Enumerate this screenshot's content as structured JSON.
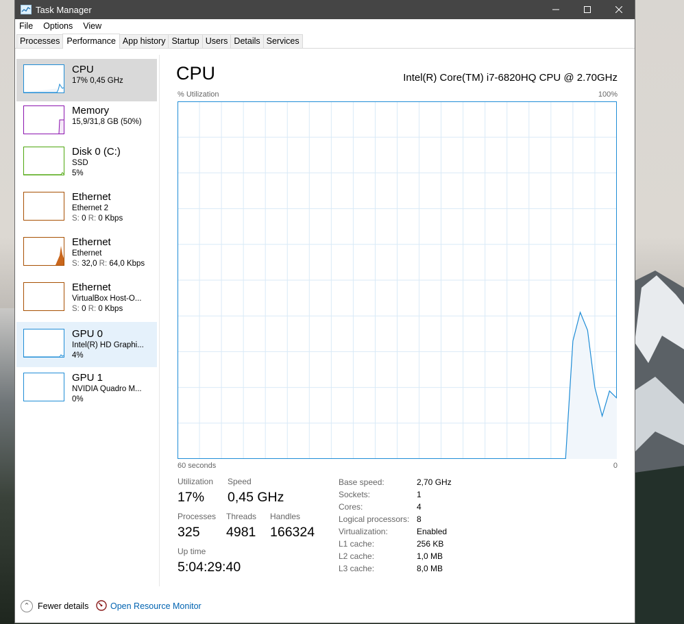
{
  "window": {
    "title": "Task Manager"
  },
  "menu": {
    "items": [
      "File",
      "Options",
      "View"
    ]
  },
  "tabs": [
    "Processes",
    "Performance",
    "App history",
    "Startup",
    "Users",
    "Details",
    "Services"
  ],
  "active_tab": "Performance",
  "sidebar": {
    "items": [
      {
        "name": "CPU",
        "sub": "17% 0,45 GHz",
        "sub2": "",
        "state": "selected",
        "color": "#1e8cd6"
      },
      {
        "name": "Memory",
        "sub": "15,9/31,8 GB (50%)",
        "sub2": "",
        "state": "",
        "color": "#8b12ae"
      },
      {
        "name": "Disk 0 (C:)",
        "sub": "SSD",
        "sub2": "5%",
        "state": "",
        "color": "#4da60c"
      },
      {
        "name": "Ethernet",
        "sub": "Ethernet 2",
        "sub2_label_s": "S:",
        "sub2_val_s": "0",
        "sub2_label_r": "R:",
        "sub2_val_r": "0 Kbps",
        "state": "",
        "color": "#a74f01"
      },
      {
        "name": "Ethernet",
        "sub": "Ethernet",
        "sub2_label_s": "S:",
        "sub2_val_s": "32,0",
        "sub2_label_r": "R:",
        "sub2_val_r": "64,0 Kbps",
        "state": "",
        "color": "#a74f01"
      },
      {
        "name": "Ethernet",
        "sub": "VirtualBox Host-O...",
        "sub2_label_s": "S:",
        "sub2_val_s": "0",
        "sub2_label_r": "R:",
        "sub2_val_r": "0 Kbps",
        "state": "",
        "color": "#a74f01"
      },
      {
        "name": "GPU 0",
        "sub": "Intel(R) HD Graphi...",
        "sub2": "4%",
        "state": "hover",
        "color": "#1e8cd6"
      },
      {
        "name": "GPU 1",
        "sub": "NVIDIA Quadro M...",
        "sub2": "0%",
        "state": "",
        "color": "#1e8cd6"
      }
    ]
  },
  "main": {
    "title": "CPU",
    "model": "Intel(R) Core(TM) i7-6820HQ CPU @ 2.70GHz",
    "graph_label": "% Utilization",
    "graph_max": "100%",
    "time_left": "60 seconds",
    "time_right": "0",
    "stats": {
      "utilization_label": "Utilization",
      "utilization": "17%",
      "speed_label": "Speed",
      "speed": "0,45 GHz",
      "processes_label": "Processes",
      "processes": "325",
      "threads_label": "Threads",
      "threads": "4981",
      "handles_label": "Handles",
      "handles": "166324",
      "uptime_label": "Up time",
      "uptime": "5:04:29:40"
    },
    "details": [
      {
        "label": "Base speed:",
        "value": "2,70 GHz"
      },
      {
        "label": "Sockets:",
        "value": "1"
      },
      {
        "label": "Cores:",
        "value": "4"
      },
      {
        "label": "Logical processors:",
        "value": "8"
      },
      {
        "label": "Virtualization:",
        "value": "Enabled"
      },
      {
        "label": "L1 cache:",
        "value": "256 KB"
      },
      {
        "label": "L2 cache:",
        "value": "1,0 MB"
      },
      {
        "label": "L3 cache:",
        "value": "8,0 MB"
      }
    ]
  },
  "cpu_history": [
    0,
    0,
    0,
    0,
    0,
    0,
    0,
    0,
    0,
    0,
    0,
    0,
    0,
    0,
    0,
    0,
    0,
    0,
    0,
    0,
    0,
    0,
    0,
    0,
    0,
    0,
    0,
    0,
    0,
    0,
    0,
    0,
    0,
    0,
    0,
    0,
    0,
    0,
    0,
    0,
    0,
    0,
    0,
    0,
    0,
    0,
    0,
    0,
    0,
    0,
    0,
    0,
    0,
    0,
    33,
    41,
    36,
    20,
    12,
    19,
    17
  ],
  "footer": {
    "fewer_details": "Fewer details",
    "resource_monitor": "Open Resource Monitor"
  },
  "colors": {
    "cpu_line": "#1e8cd6",
    "cpu_fill": "#f1f6fb",
    "grid": "#d9eaf7",
    "link": "#0063b1"
  }
}
